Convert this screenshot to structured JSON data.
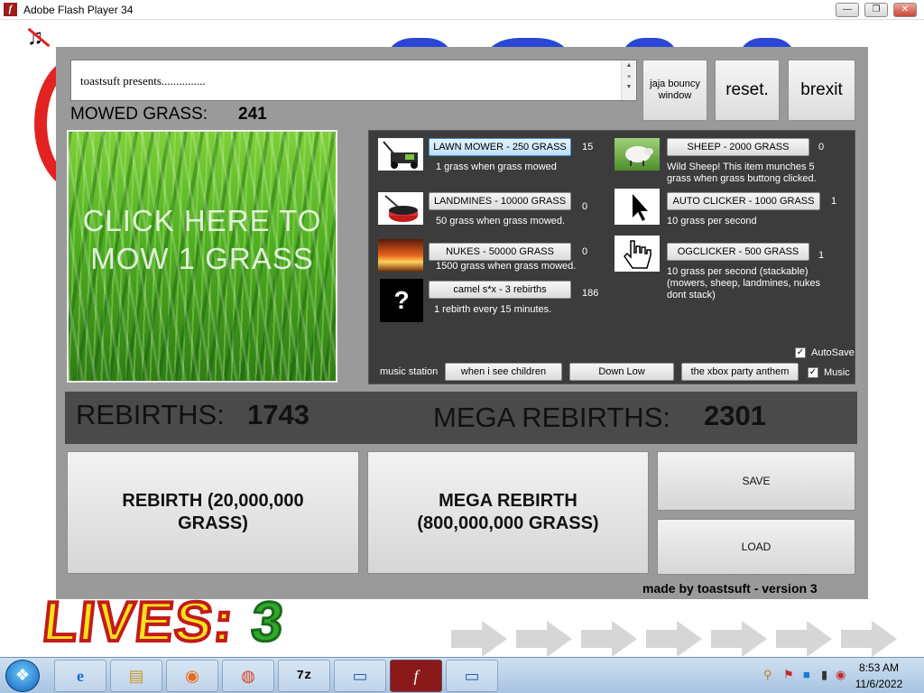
{
  "window": {
    "title": "Adobe Flash Player 34",
    "minimize": "—",
    "restore": "❐",
    "close": "✕"
  },
  "panel": {
    "textbox_text": "toastsuft presents...............",
    "jaja_button": "jaja bouncy window",
    "reset_button": "reset.",
    "brexit_button": "brexit",
    "mowed_label": "MOWED GRASS:",
    "mowed_value": "241",
    "grass_button_label": "CLICK HERE TO MOW 1 GRASS"
  },
  "shop": {
    "items": [
      {
        "button": "LAWN MOWER - 250 GRASS",
        "count": "15",
        "desc": "1 grass when grass mowed",
        "icon": "lawn-mower-icon"
      },
      {
        "button": "LANDMINES - 10000 GRASS",
        "count": "0",
        "desc": "50 grass when grass mowed.",
        "icon": "landmine-icon"
      },
      {
        "button": "NUKES - 50000 GRASS",
        "count": "0",
        "desc": "1500 grass when grass mowed.",
        "icon": "nuke-icon"
      },
      {
        "button": "camel s*x - 3 rebirths",
        "count": "186",
        "desc": "1 rebirth every 15 minutes.",
        "icon": "question-icon"
      },
      {
        "button": "SHEEP - 2000 GRASS",
        "count": "0",
        "desc": "Wild Sheep! This item munches 5 grass when grass buttong clicked.",
        "icon": "sheep-icon"
      },
      {
        "button": "AUTO CLICKER - 1000 GRASS",
        "count": "1",
        "desc": "10 grass per second",
        "icon": "cursor-icon"
      },
      {
        "button": "OGCLICKER - 500 GRASS",
        "count": "1",
        "desc": "10 grass per second (stackable) (mowers, sheep, landmines, nukes dont stack)",
        "icon": "hand-cursor-icon"
      }
    ],
    "question_mark": "?",
    "autosave_label": "AutoSave",
    "music_label": "Music",
    "music_station_label": "music station",
    "music_buttons": [
      "when i see children",
      "Down Low",
      "the xbox party anthem"
    ],
    "check_mark": "✓"
  },
  "rebirths": {
    "label": "REBIRTHS:",
    "value": "1743",
    "mega_label": "MEGA REBIRTHS:",
    "mega_value": "2301"
  },
  "actions": {
    "rebirth": "REBIRTH (20,000,000 GRASS)",
    "mega_rebirth": "MEGA REBIRTH (800,000,000 GRASS)",
    "save": "SAVE",
    "load": "LOAD"
  },
  "footer": "made by toastsuft - version 3",
  "background": {
    "lives_label": "LIVES:",
    "lives_value": "3"
  },
  "taskbar": {
    "time": "8:53 AM",
    "date": "11/6/2022"
  }
}
